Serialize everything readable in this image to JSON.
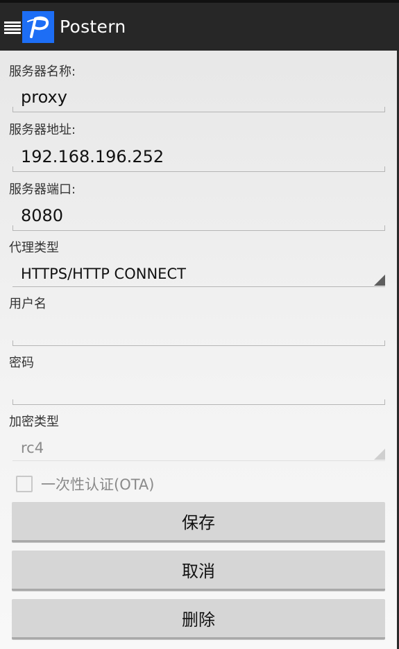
{
  "app": {
    "title": "Postern",
    "logo_letter": "P"
  },
  "form": {
    "server_name": {
      "label": "服务器名称:",
      "value": "proxy"
    },
    "server_address": {
      "label": "服务器地址:",
      "value": "192.168.196.252"
    },
    "server_port": {
      "label": "服务器端口:",
      "value": "8080"
    },
    "proxy_type": {
      "label": "代理类型",
      "value": "HTTPS/HTTP CONNECT"
    },
    "username": {
      "label": "用户名",
      "value": ""
    },
    "password": {
      "label": "密码",
      "value": ""
    },
    "encryption": {
      "label": "加密类型",
      "value": "rc4"
    },
    "ota": {
      "label": "一次性认证(OTA)",
      "checked": false
    }
  },
  "buttons": {
    "save": "保存",
    "cancel": "取消",
    "delete": "删除"
  },
  "colors": {
    "actionbar": "#272727",
    "logo_bg": "#1d6ef5",
    "button_bg": "#d6d6d6"
  }
}
